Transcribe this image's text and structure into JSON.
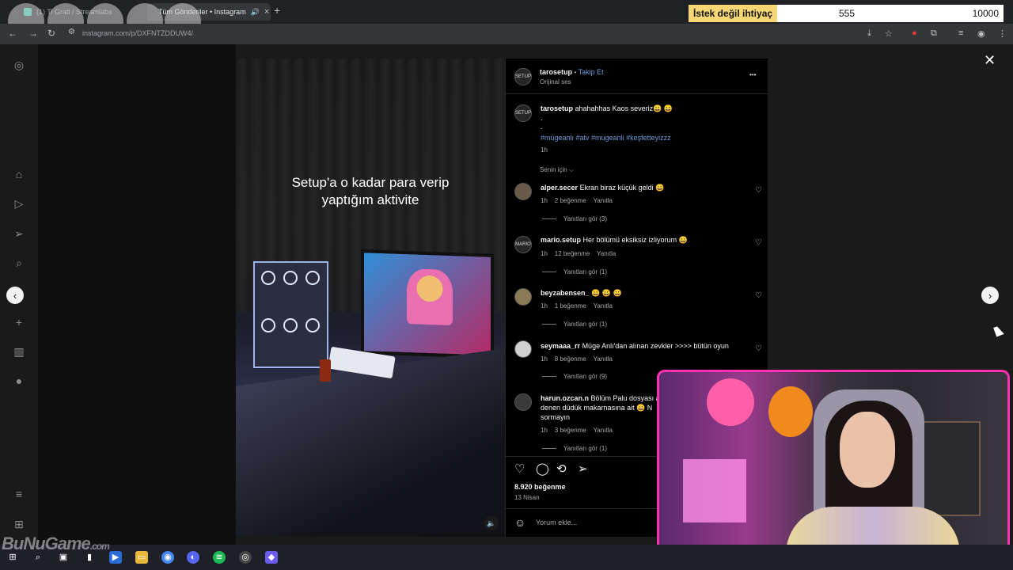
{
  "browser": {
    "tabs": [
      {
        "label": "(1) Ti Grati / Streamlabs"
      },
      {
        "label": "Tüm Gönderiler • Instagram",
        "favicon_color": "#e1306c"
      }
    ],
    "url": "instagram.com/p/DXFNTZDDUW4/"
  },
  "overlay": {
    "goal_label": "İstek değil ihtiyaç",
    "current": "555",
    "goal": "10000",
    "accent": "#f7d774"
  },
  "leftnav_icons": [
    "instagram-icon",
    "home-icon",
    "reels-icon",
    "send-icon",
    "search-icon",
    "explore-icon",
    "create-icon",
    "dashboard-icon",
    "profile-icon",
    "menu-icon",
    "apps-icon"
  ],
  "video": {
    "caption_line1": "Setup'a o kadar para verip",
    "caption_line2": "yaptığım aktivite"
  },
  "post": {
    "author": "tarosetup",
    "follow": "Takip Et",
    "audio": "Orijinal ses",
    "more": "•••",
    "caption_text": "ahahahhas Kaos severiz😀 😀",
    "caption_dot1": ".",
    "caption_dot2": ".",
    "hashtags": "#mügeanlı #atv #mugeanli #keşfetteyizzz",
    "time": "1h",
    "sort_label": "Senin için ⌵",
    "likes": "8.920 beğenme",
    "date": "13 Nisan",
    "comment_placeholder": "Yorum ekle..."
  },
  "comments": [
    {
      "user": "alper.secer",
      "text": "Ekran biraz küçük geldi 😀",
      "time": "1h",
      "likes": "2 beğenme",
      "reply": "Yanıtla",
      "view_replies": "Yanıtları gör (3)"
    },
    {
      "user": "mario.setup",
      "text": "Her bölümü eksiksiz izliyorum 😀",
      "time": "1h",
      "likes": "12 beğenme",
      "reply": "Yanıtla",
      "view_replies": "Yanıtları gör (1)"
    },
    {
      "user": "beyzabensen_",
      "text": "😀 😀 😀",
      "time": "1h",
      "likes": "1 beğenme",
      "reply": "Yanıtla",
      "view_replies": "Yanıtları gör (1)"
    },
    {
      "user": "seymaaa_rr",
      "text": "Müge Anlı'dan alınan zevkler >>>> bütün oyun",
      "time": "1h",
      "likes": "8 beğenme",
      "reply": "Yanıtla",
      "view_replies": "Yanıtları gör (9)"
    },
    {
      "user": "harun.ozcan.n",
      "text": "Bölüm Palu dosyası a",
      "text2": "denen düdük makarnasına ait 😀 N",
      "text3": "sormayın",
      "time": "1h",
      "likes": "3 beğenme",
      "reply": "Yanıtla",
      "view_replies": "Yanıtları gör (1)"
    }
  ],
  "avatar_labels": {
    "tarosetup": "SETUP",
    "mario": "MARIO"
  },
  "watermark": "BuNuGame",
  "watermark_suffix": ".com"
}
